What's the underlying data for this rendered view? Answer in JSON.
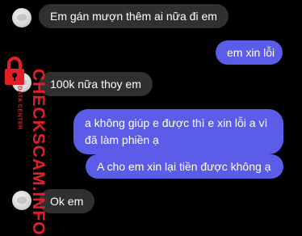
{
  "messages": [
    {
      "side": "in",
      "text": "Em gán mượn thêm ai nữa đi em"
    },
    {
      "side": "out",
      "text": "em xin lỗi"
    },
    {
      "side": "in",
      "text": "100k nữa thoy em"
    },
    {
      "side": "out",
      "text": "a không giúp e được thì e xin lỗi a vì đã làm phiền ạ"
    },
    {
      "side": "out",
      "text": "A cho em xin lại tiền được không ạ"
    },
    {
      "side": "in",
      "text": "Ok em"
    }
  ],
  "watermark": {
    "brand": "CHECKSCAM.INFO",
    "sub": "DATA CENTER",
    "color": "#e21f26"
  },
  "colors": {
    "incoming": "#303030",
    "outgoing": "#5b5ce8",
    "background": "#000000"
  }
}
